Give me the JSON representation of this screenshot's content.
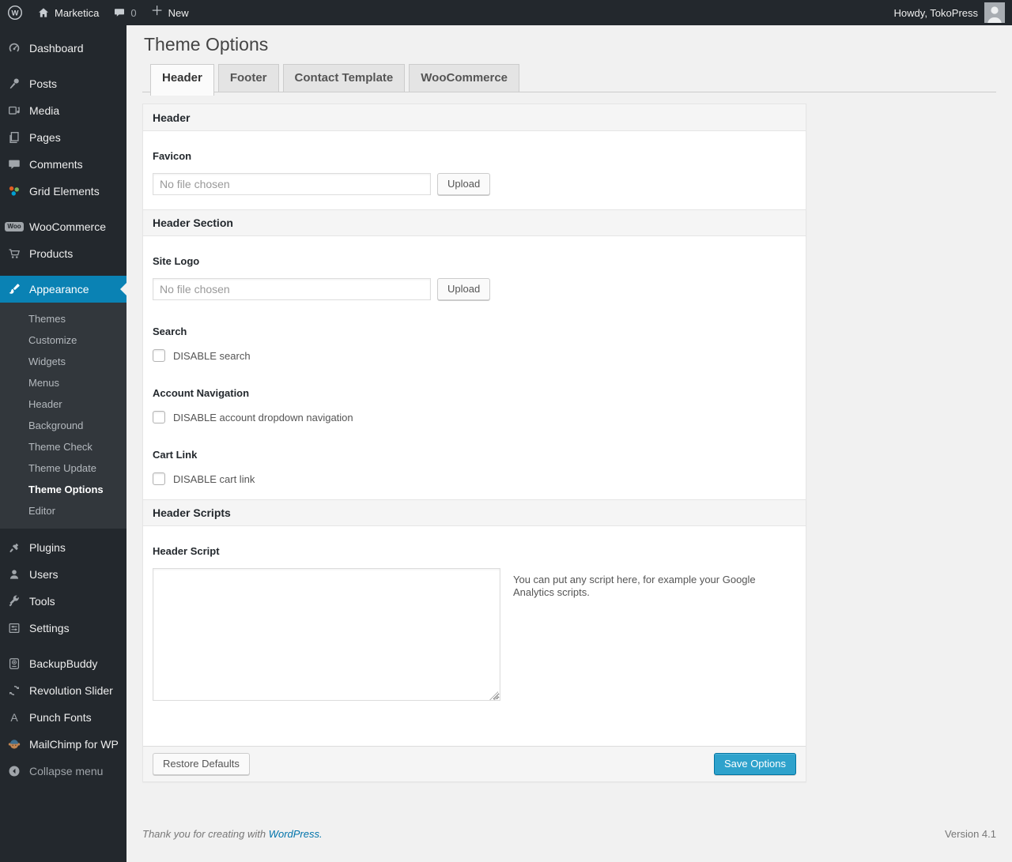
{
  "admin_bar": {
    "site_name": "Marketica",
    "comment_count": "0",
    "new_label": "New",
    "howdy_text": "Howdy, TokoPress"
  },
  "sidebar": {
    "items": [
      {
        "label": "Dashboard"
      },
      {
        "label": "Posts"
      },
      {
        "label": "Media"
      },
      {
        "label": "Pages"
      },
      {
        "label": "Comments"
      },
      {
        "label": "Grid Elements"
      },
      {
        "label": "WooCommerce"
      },
      {
        "label": "Products"
      },
      {
        "label": "Appearance"
      },
      {
        "label": "Plugins"
      },
      {
        "label": "Users"
      },
      {
        "label": "Tools"
      },
      {
        "label": "Settings"
      },
      {
        "label": "BackupBuddy"
      },
      {
        "label": "Revolution Slider"
      },
      {
        "label": "Punch Fonts"
      },
      {
        "label": "MailChimp for WP"
      },
      {
        "label": "Collapse menu"
      }
    ],
    "appearance_submenu": [
      {
        "label": "Themes"
      },
      {
        "label": "Customize"
      },
      {
        "label": "Widgets"
      },
      {
        "label": "Menus"
      },
      {
        "label": "Header"
      },
      {
        "label": "Background"
      },
      {
        "label": "Theme Check"
      },
      {
        "label": "Theme Update"
      },
      {
        "label": "Theme Options"
      },
      {
        "label": "Editor"
      }
    ],
    "current_submenu_item": "Theme Options",
    "woo_badge": "Woo",
    "punch_fonts_glyph": "A"
  },
  "page": {
    "title": "Theme Options",
    "tabs": [
      {
        "label": "Header",
        "active": true
      },
      {
        "label": "Footer",
        "active": false
      },
      {
        "label": "Contact Template",
        "active": false
      },
      {
        "label": "WooCommerce",
        "active": false
      }
    ]
  },
  "panel": {
    "section_header_1": "Header",
    "section_header_2": "Header Section",
    "section_header_3": "Header Scripts",
    "favicon": {
      "label": "Favicon",
      "placeholder": "No file chosen",
      "upload_label": "Upload"
    },
    "site_logo": {
      "label": "Site Logo",
      "placeholder": "No file chosen",
      "upload_label": "Upload"
    },
    "search": {
      "label": "Search",
      "checkbox_label": "DISABLE search",
      "checked": false
    },
    "account_navigation": {
      "label": "Account Navigation",
      "checkbox_label": "DISABLE account dropdown navigation",
      "checked": false
    },
    "cart_link": {
      "label": "Cart Link",
      "checkbox_label": "DISABLE cart link",
      "checked": false
    },
    "header_script": {
      "label": "Header Script",
      "value": "",
      "help_text": "You can put any script here, for example your Google Analytics scripts."
    },
    "footer": {
      "restore_label": "Restore Defaults",
      "save_label": "Save Options"
    }
  },
  "page_footer": {
    "thanks_text": "Thank you for creating with",
    "wordpress_link": "WordPress.",
    "version": "Version 4.1"
  },
  "colors": {
    "admin_dark": "#23282d",
    "submenu_dark": "#32373c",
    "menu_highlight": "#0a82b4",
    "primary_button": "#2ea2cc",
    "link_blue": "#0073aa",
    "page_background": "#f1f1f1"
  }
}
